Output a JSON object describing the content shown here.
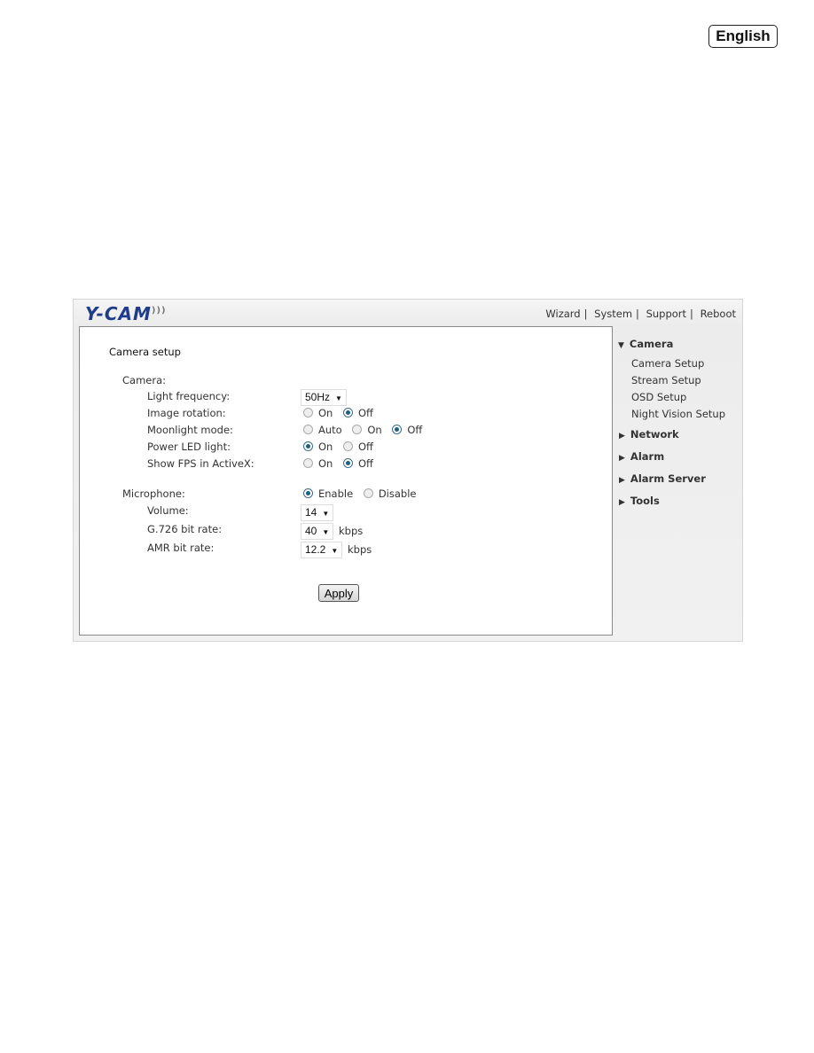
{
  "language_button": "English",
  "logo": "Y-CAM",
  "top_nav": [
    "Wizard",
    "System",
    "Support",
    "Reboot"
  ],
  "page_title": "Camera setup",
  "camera": {
    "section": "Camera:",
    "light_frequency": {
      "label": "Light frequency:",
      "value": "50Hz"
    },
    "image_rotation": {
      "label": "Image rotation:",
      "options": [
        "On",
        "Off"
      ],
      "selected": "Off"
    },
    "moonlight_mode": {
      "label": "Moonlight mode:",
      "options": [
        "Auto",
        "On",
        "Off"
      ],
      "selected": "Off"
    },
    "power_led": {
      "label": "Power LED light:",
      "options": [
        "On",
        "Off"
      ],
      "selected": "On"
    },
    "show_fps": {
      "label": "Show FPS in ActiveX:",
      "options": [
        "On",
        "Off"
      ],
      "selected": "Off"
    }
  },
  "microphone": {
    "label": "Microphone:",
    "options": [
      "Enable",
      "Disable"
    ],
    "selected": "Enable",
    "volume": {
      "label": "Volume:",
      "value": "14"
    },
    "g726": {
      "label": "G.726 bit rate:",
      "value": "40",
      "unit": "kbps"
    },
    "amr": {
      "label": "AMR bit rate:",
      "value": "12.2",
      "unit": "kbps"
    }
  },
  "apply": "Apply",
  "sidebar": {
    "camera": "Camera",
    "camera_items": [
      "Camera Setup",
      "Stream Setup",
      "OSD Setup",
      "Night Vision Setup"
    ],
    "sections": [
      "Network",
      "Alarm",
      "Alarm Server",
      "Tools"
    ]
  }
}
